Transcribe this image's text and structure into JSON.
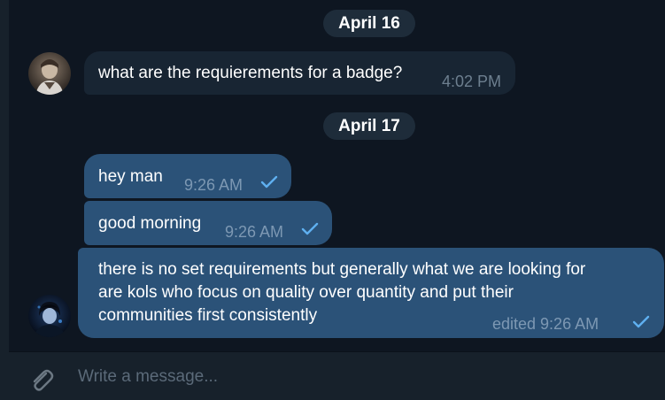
{
  "dates": [
    "April 16",
    "April 17"
  ],
  "messages": [
    {
      "text": "what are the requierements for a badge?",
      "time": "4:02 PM",
      "direction": "incoming"
    },
    {
      "text": "hey man",
      "time": "9:26 AM",
      "direction": "outgoing"
    },
    {
      "text": "good morning",
      "time": "9:26 AM",
      "direction": "outgoing"
    },
    {
      "lines": [
        "there is no set requirements but generally what we are looking for",
        "are kols who focus on quality over quantity and put their",
        "communities first consistently"
      ],
      "time": "edited 9:26 AM",
      "direction": "outgoing"
    }
  ],
  "composer": {
    "placeholder": "Write a message..."
  },
  "colors": {
    "background": "#0e1621",
    "incoming_bubble": "#182533",
    "outgoing_bubble": "#2b5278",
    "date_pill": "#1e2c3a",
    "check": "#5fb0f0",
    "panel": "#17212b"
  },
  "icons": {
    "sent_status": "check-icon",
    "attach": "paperclip-icon"
  }
}
